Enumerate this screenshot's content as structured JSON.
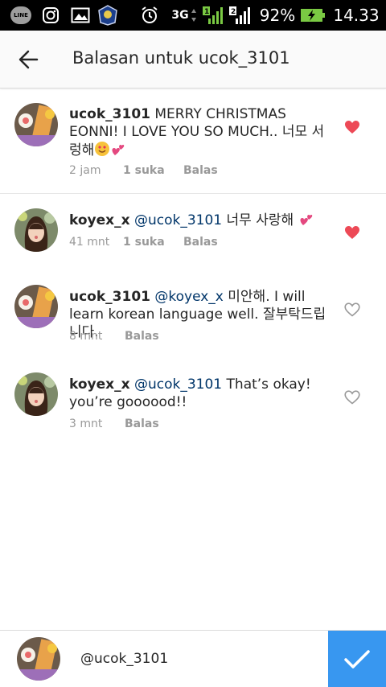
{
  "status_bar": {
    "line_label": "LINE",
    "network": "3G",
    "battery_percent": "92%",
    "time": "14.33"
  },
  "header": {
    "title": "Balasan untuk ucok_3101"
  },
  "comments": [
    {
      "username": "ucok_3101",
      "mention": "",
      "text": "MERRY CHRISTMAS EONNI! I LOVE YOU SO MUCH.. 너모 서렁해",
      "time": "2 jam",
      "likes": "1 suka",
      "reply": "Balas",
      "liked": true
    },
    {
      "username": "koyex_x",
      "mention": "@ucok_3101",
      "text": "너무 사랑해",
      "time": "41 mnt",
      "likes": "1 suka",
      "reply": "Balas",
      "liked": true
    },
    {
      "username": "ucok_3101",
      "mention": "@koyex_x",
      "text": "미안해. I will learn korean language well. 잘부탁드립니다.",
      "time": "8 mnt",
      "likes": "",
      "reply": "Balas",
      "liked": false
    },
    {
      "username": "koyex_x",
      "mention": "@ucok_3101",
      "text": "That’s okay! you’re goooood!!",
      "time": "3 mnt",
      "likes": "",
      "reply": "Balas",
      "liked": false
    }
  ],
  "composer": {
    "value": "@ucok_3101"
  },
  "colors": {
    "liked_heart": "#ed4956",
    "mention": "#003569",
    "send_button": "#3897f0",
    "status_green": "#7ac943"
  }
}
